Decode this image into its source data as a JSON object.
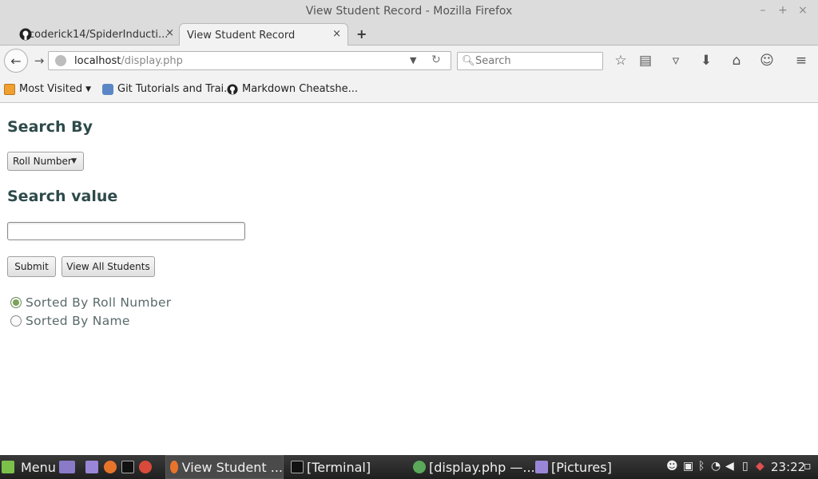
{
  "window": {
    "title": "View Student Record - Mozilla Firefox",
    "controls": [
      "–",
      "+",
      "×"
    ]
  },
  "tabs": [
    {
      "label": "coderick14/SpiderInducti...",
      "close": "×",
      "icon": "github-icon"
    },
    {
      "label": "View Student Record",
      "close": "×"
    }
  ],
  "newtab_label": "+",
  "nav": {
    "url_host": "localhost",
    "url_path": "/display.php",
    "search_placeholder": "Search"
  },
  "bookmarks": [
    {
      "label": "Most Visited",
      "icon": "folder-icon"
    },
    {
      "label": "Git Tutorials and Trai...",
      "icon": "database-icon"
    },
    {
      "label": "Markdown Cheatshe...",
      "icon": "github-icon"
    }
  ],
  "page": {
    "search_by_heading": "Search By",
    "select_value": "Roll Number",
    "search_value_heading": "Search value",
    "search_input_value": "",
    "submit_label": "Submit",
    "view_all_label": "View All Students",
    "radio_options": [
      {
        "label": "Sorted By Roll Number",
        "checked": true
      },
      {
        "label": "Sorted By Name",
        "checked": false
      }
    ]
  },
  "taskbar": {
    "menu_label": "Menu",
    "windows": [
      {
        "label": "View Student ...",
        "active": true
      },
      {
        "label": "[Terminal]",
        "active": false
      },
      {
        "label": "[display.php —...",
        "active": false
      },
      {
        "label": "[Pictures]",
        "active": false
      }
    ],
    "clock": "23:22"
  }
}
